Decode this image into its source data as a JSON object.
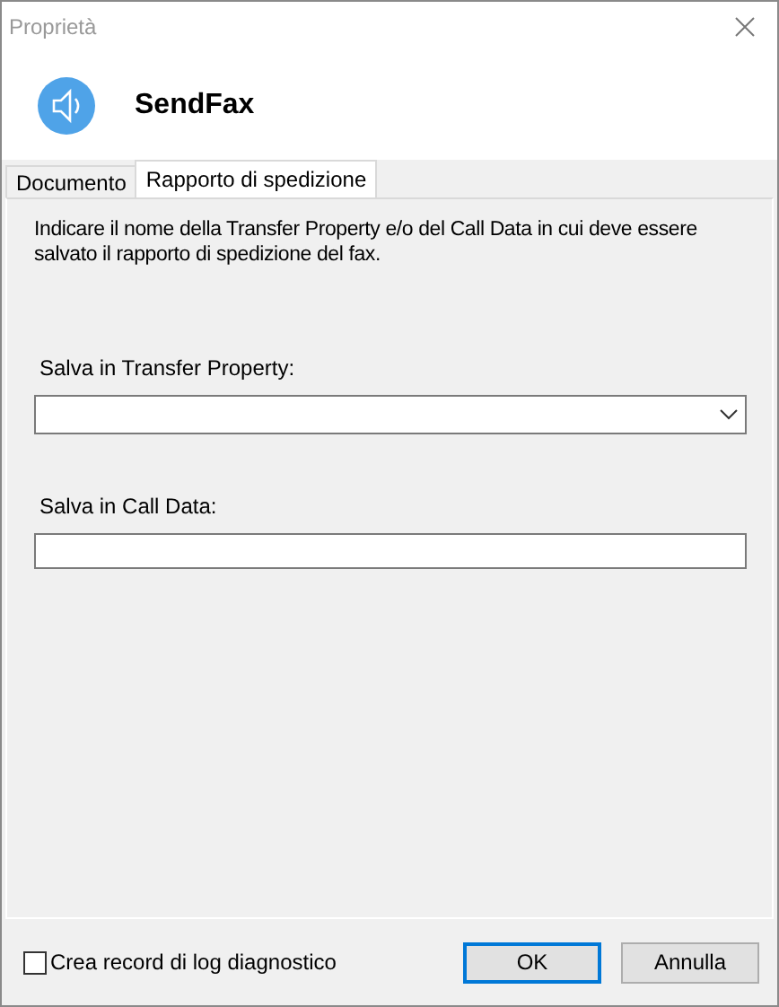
{
  "window": {
    "title": "Proprietà"
  },
  "header": {
    "title": "SendFax"
  },
  "tabs": [
    {
      "label": "Documento",
      "selected": false
    },
    {
      "label": "Rapporto di spedizione",
      "selected": true
    }
  ],
  "panel": {
    "description": "Indicare il nome della Transfer Property e/o del Call Data in cui deve essere salvato il rapporto di spedizione del fax.",
    "fields": [
      {
        "kind": "combo",
        "label": "Salva in Transfer Property:"
      },
      {
        "kind": "text",
        "label": "Salva in Call Data:"
      }
    ]
  },
  "footer": {
    "checkbox": {
      "label": "Crea record di log diagnostico",
      "checked": false
    },
    "buttons": [
      {
        "label": "OK",
        "default": true
      },
      {
        "label": "Annulla",
        "default": false
      }
    ]
  }
}
